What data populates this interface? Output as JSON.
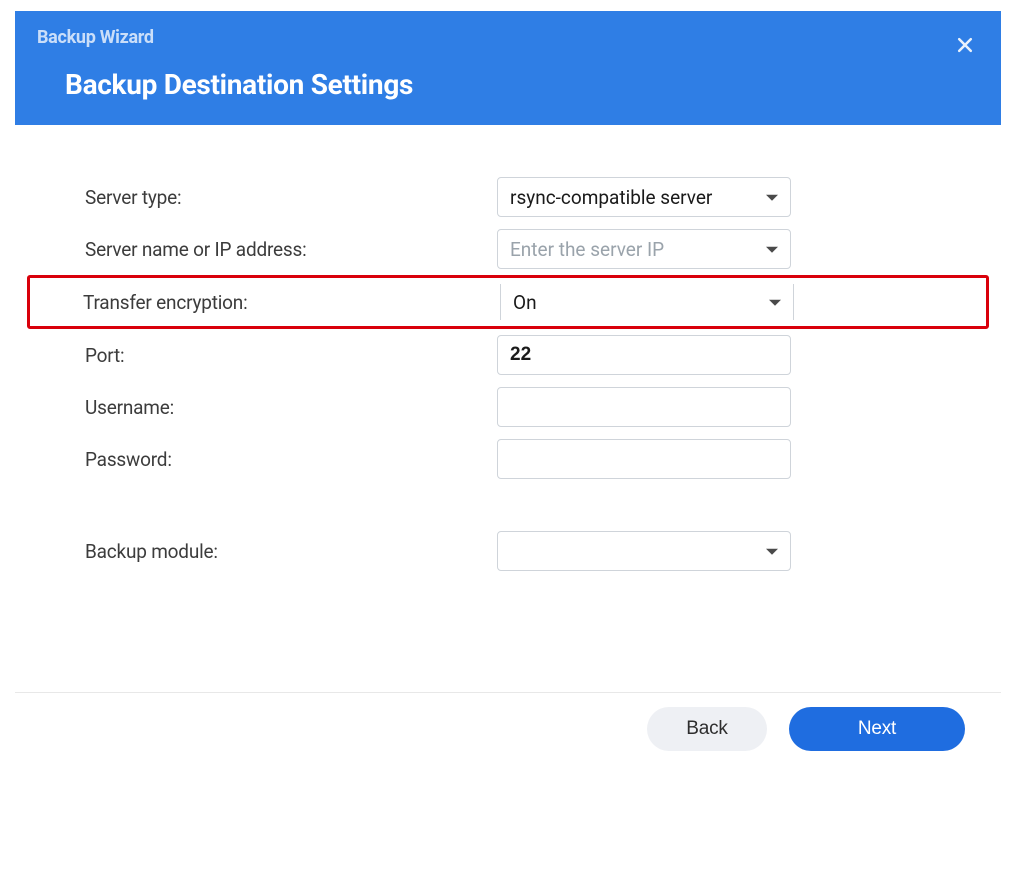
{
  "header": {
    "wizard_title": "Backup Wizard",
    "page_title": "Backup Destination Settings"
  },
  "form": {
    "server_type": {
      "label": "Server type:",
      "value": "rsync-compatible server"
    },
    "server_name": {
      "label": "Server name or IP address:",
      "placeholder": "Enter the server IP",
      "value": ""
    },
    "transfer_encryption": {
      "label": "Transfer encryption:",
      "value": "On"
    },
    "port": {
      "label": "Port:",
      "value": "22"
    },
    "username": {
      "label": "Username:",
      "value": ""
    },
    "password": {
      "label": "Password:",
      "value": ""
    },
    "backup_module": {
      "label": "Backup module:",
      "value": ""
    }
  },
  "footer": {
    "back": "Back",
    "next": "Next"
  }
}
